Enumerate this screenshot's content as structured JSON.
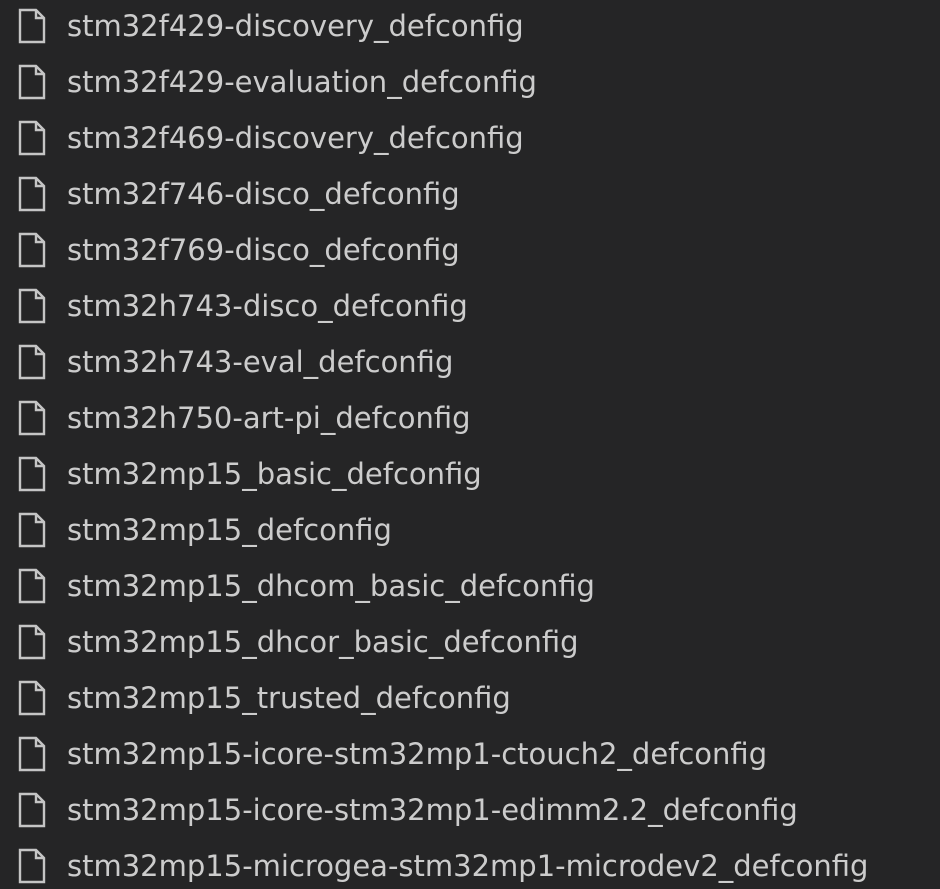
{
  "explorer": {
    "files": [
      {
        "label": "stm32f429-discovery_defconfig",
        "icon": "file-icon"
      },
      {
        "label": "stm32f429-evaluation_defconfig",
        "icon": "file-icon"
      },
      {
        "label": "stm32f469-discovery_defconfig",
        "icon": "file-icon"
      },
      {
        "label": "stm32f746-disco_defconfig",
        "icon": "file-icon"
      },
      {
        "label": "stm32f769-disco_defconfig",
        "icon": "file-icon"
      },
      {
        "label": "stm32h743-disco_defconfig",
        "icon": "file-icon"
      },
      {
        "label": "stm32h743-eval_defconfig",
        "icon": "file-icon"
      },
      {
        "label": "stm32h750-art-pi_defconfig",
        "icon": "file-icon"
      },
      {
        "label": "stm32mp15_basic_defconfig",
        "icon": "file-icon"
      },
      {
        "label": "stm32mp15_defconfig",
        "icon": "file-icon"
      },
      {
        "label": "stm32mp15_dhcom_basic_defconfig",
        "icon": "file-icon"
      },
      {
        "label": "stm32mp15_dhcor_basic_defconfig",
        "icon": "file-icon"
      },
      {
        "label": "stm32mp15_trusted_defconfig",
        "icon": "file-icon"
      },
      {
        "label": "stm32mp15-icore-stm32mp1-ctouch2_defconfig",
        "icon": "file-icon"
      },
      {
        "label": "stm32mp15-icore-stm32mp1-edimm2.2_defconfig",
        "icon": "file-icon"
      },
      {
        "label": "stm32mp15-microgea-stm32mp1-microdev2_defconfig",
        "icon": "file-icon"
      }
    ],
    "colors": {
      "background": "#252526",
      "text": "#cccccc",
      "icon_stroke": "#c5c5c5"
    }
  }
}
